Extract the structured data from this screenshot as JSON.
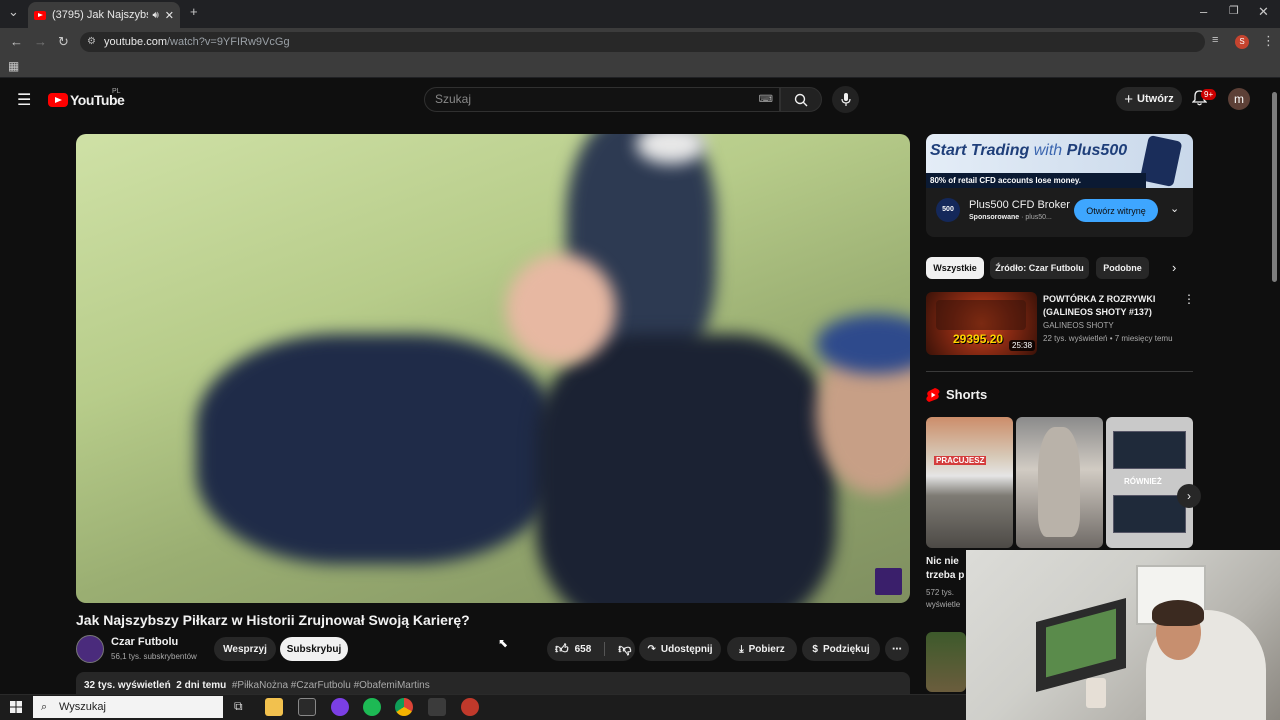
{
  "browser": {
    "tab_title": "(3795) Jak Najszybszy Piłka",
    "url_host": "youtube.com",
    "url_path": "/watch?v=9YFIRw9VcGg",
    "profile_initial": "S"
  },
  "header": {
    "logo_text": "YouTube",
    "region": "PL",
    "search_placeholder": "Szukaj",
    "create_label": "Utwórz",
    "notifications": "9+",
    "avatar_initial": "m"
  },
  "video": {
    "title": "Jak Najszybszy Piłkarz w Historii Zrujnował Swoją Karierę?",
    "channel": "Czar Futbolu",
    "subscribers": "56,1 tys. subskrybentów",
    "support_label": "Wesprzyj",
    "subscribe_label": "Subskrybuj",
    "likes": "658",
    "share_label": "Udostępnij",
    "download_label": "Pobierz",
    "thanks_label": "Podziękuj",
    "views": "32 tys. wyświetleń",
    "age": "2 dni temu",
    "hashtags": "#PiłkaNożna #CzarFutbolu #ObafemiMartins"
  },
  "ad": {
    "headline_a": "Start Trading",
    "headline_b": "with",
    "headline_c": "Plus500",
    "warning": "80% of retail CFD accounts lose money.",
    "logo_text": "500",
    "name": "Plus500 CFD Broker",
    "sponsored": "Sponsorowane",
    "domain": "· plus50...",
    "cta": "Otwórz witrynę"
  },
  "chips": [
    {
      "label": "Wszystkie"
    },
    {
      "label": "Źródło: Czar Futbolu"
    },
    {
      "label": "Podobne"
    }
  ],
  "recommended": {
    "title": "POWTÓRKA Z ROZRYWKI (GALINEOS SHOTY #137)",
    "channel": "GALINEOS SHOTY",
    "meta": "22 tys. wyświetleń • 7 miesięcy temu",
    "duration": "25:38",
    "thumb_number": "29395.20"
  },
  "shorts": {
    "title": "Shorts",
    "items": [
      {
        "overlay": "PRACUJESZ",
        "caption": "Nic nie trzeba p",
        "views": "572 tys. wyświetle"
      },
      {
        "overlay": ""
      },
      {
        "overlay": "RÓWNIEŻ"
      }
    ]
  },
  "taskbar": {
    "search_label": "Wyszukaj"
  },
  "colors": {
    "accent_red": "#ff0000",
    "link_blue": "#3ea6ff",
    "bg": "#0f0f0f"
  }
}
